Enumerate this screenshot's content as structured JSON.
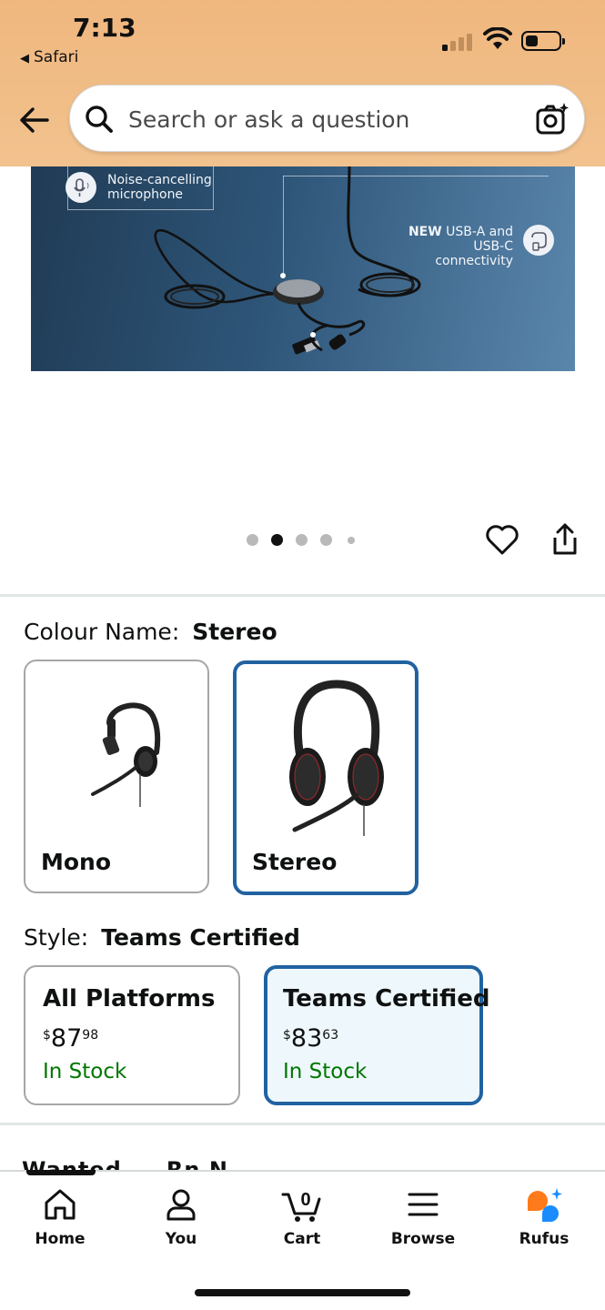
{
  "status_bar": {
    "time": "7:13",
    "back_app": "Safari",
    "icons": [
      "cellular-signal-icon",
      "wifi-icon",
      "battery-icon"
    ]
  },
  "header": {
    "search_placeholder": "Search or ask a question",
    "icons": [
      "back-arrow-icon",
      "search-icon",
      "camera-icon"
    ]
  },
  "product_image": {
    "callout_mic": "Noise-cancelling microphone",
    "callout_usb_bold": "NEW",
    "callout_usb_line1": " USB-A and",
    "callout_usb_line2": "USB-C connectivity",
    "carousel_count": 5,
    "carousel_active": 2
  },
  "colour": {
    "label": "Colour Name:",
    "selected": "Stereo",
    "options": [
      {
        "name": "Mono"
      },
      {
        "name": "Stereo"
      }
    ]
  },
  "style": {
    "label": "Style:",
    "selected": "Teams Certified",
    "options": [
      {
        "title": "All Platforms",
        "currency": "$",
        "whole": "87",
        "fraction": "98",
        "stock": "In Stock"
      },
      {
        "title": "Teams Certified",
        "currency": "$",
        "whole": "83",
        "fraction": "63",
        "stock": "In Stock"
      }
    ]
  },
  "peek_section_text": "Wanted ... Rn N",
  "bottom_nav": {
    "items": [
      {
        "label": "Home",
        "icon": "home-icon"
      },
      {
        "label": "You",
        "icon": "user-icon"
      },
      {
        "label": "Cart",
        "icon": "cart-icon",
        "badge": "0"
      },
      {
        "label": "Browse",
        "icon": "menu-icon"
      },
      {
        "label": "Rufus",
        "icon": "rufus-icon"
      }
    ]
  },
  "colors": {
    "header_bg": "#efb77e",
    "selected_border": "#2162a1",
    "stock_green": "#007600",
    "rufus_orange": "#ff7a1a",
    "rufus_blue": "#1a8cff"
  }
}
